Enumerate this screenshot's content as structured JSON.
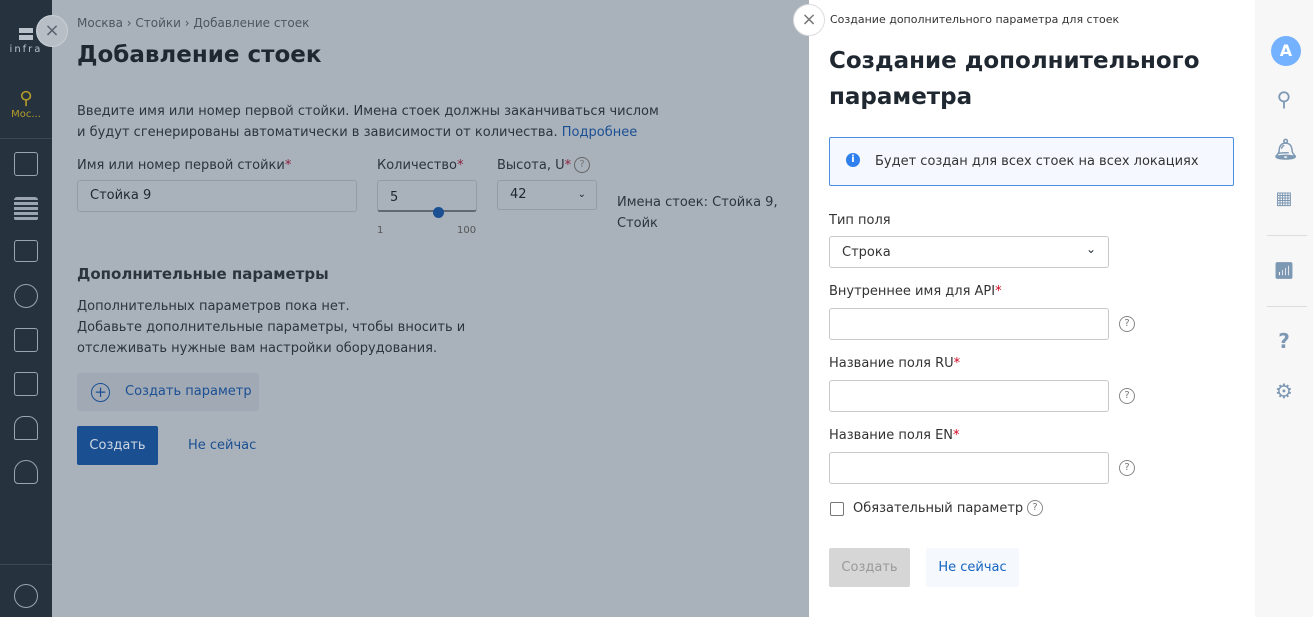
{
  "sidebar": {
    "logo": "infra",
    "location": "Мос...",
    "items": [
      "plan",
      "racks",
      "devices",
      "power",
      "network",
      "storage",
      "rooms",
      "users"
    ]
  },
  "main": {
    "breadcrumb": "Москва › Стойки › Добавление стоек",
    "title": "Добавление стоек",
    "intro1": "Введите имя или номер первой стойки. Имена стоек должны заканчиваться числом",
    "intro2": "и будут сгенерированы автоматически в зависимости от количества.",
    "more_link": "Подробнее",
    "name_label": "Имя или номер первой стойки",
    "name_value": "Стойка 9",
    "qty_label": "Количество",
    "qty_value": "5",
    "qty_min": "1",
    "qty_max": "100",
    "qty_slider": 5,
    "height_label": "Высота, U",
    "height_value": "42",
    "names_preview": "Имена стоек: Стойка 9, Стойк",
    "extra_title": "Дополнительные параметры",
    "extra1": "Дополнительных параметров пока нет.",
    "extra2": "Добавьте дополнительные параметры, чтобы вносить и",
    "extra3": "отслеживать нужные вам настройки оборудования.",
    "create_param": "Создать параметр",
    "create": "Создать",
    "not_now": "Не сейчас"
  },
  "panel": {
    "breadcrumb": "Создание дополнительного параметра для стоек",
    "title1": "Создание дополнительного",
    "title2": "параметра",
    "info": "Будет создан для всех стоек на всех локациях",
    "type_label": "Тип поля",
    "type_value": "Строка",
    "api_label": "Внутреннее имя для API",
    "ru_label": "Название поля RU",
    "en_label": "Название поля EN",
    "required_label": "Обязательный параметр",
    "create": "Создать",
    "not_now": "Не сейчас"
  },
  "rail": {
    "avatar": "A"
  },
  "colors": {
    "accent": "#1565c0",
    "info_bg": "#f5f9ff",
    "info_border": "#4a90e2",
    "avatar": "#74b2ff"
  }
}
